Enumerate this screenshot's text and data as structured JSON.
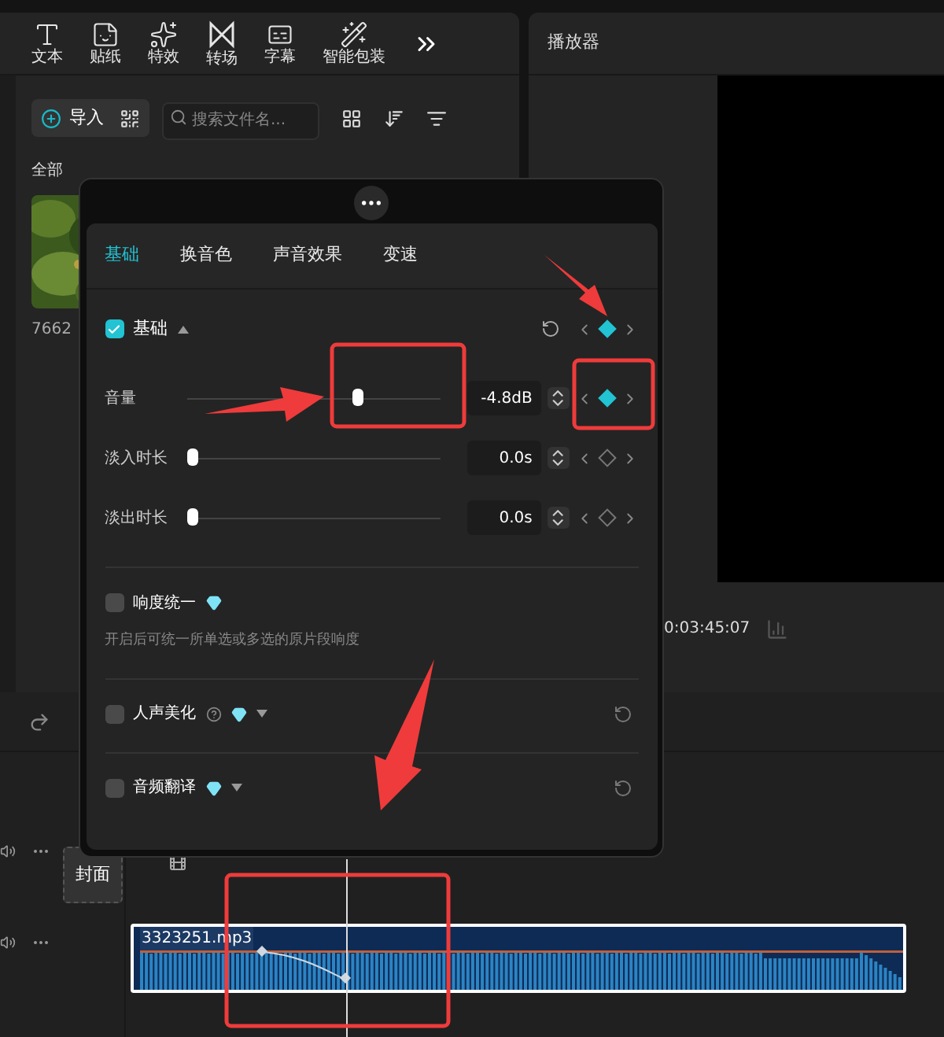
{
  "toolbar": {
    "tools": [
      {
        "label": "文本",
        "kind": "text"
      },
      {
        "label": "贴纸",
        "kind": "sticker"
      },
      {
        "label": "特效",
        "kind": "effect"
      },
      {
        "label": "转场",
        "kind": "transition"
      },
      {
        "label": "字幕",
        "kind": "caption"
      },
      {
        "label": "智能包装",
        "kind": "smart"
      }
    ]
  },
  "media": {
    "import": "导入",
    "search": {
      "placeholder": "搜索文件名..."
    },
    "filter": "全部",
    "items": [
      {
        "name": "7662",
        "kind": "picture"
      }
    ]
  },
  "player": {
    "title": "播放器",
    "timecode": "0:03:45:07"
  },
  "timeline": {
    "cover": "封面",
    "clip": {
      "name": "3323251.mp3"
    }
  },
  "popup": {
    "tabs": [
      {
        "label": "基础",
        "selected": true
      },
      {
        "label": "换音色",
        "selected": false
      },
      {
        "label": "声音效果",
        "selected": false
      },
      {
        "label": "变速",
        "selected": false
      }
    ],
    "basic": {
      "label": "基础",
      "checked": true,
      "expanded": true,
      "keyframe_active": true
    },
    "params": [
      {
        "label": "音量",
        "level": 0.68,
        "value": "-4.8dB",
        "keyframe_active": true
      },
      {
        "label": "淡入时长",
        "level": 0,
        "value": "0.0s",
        "keyframe_active": false
      },
      {
        "label": "淡出时长",
        "level": 0,
        "value": "0.0s",
        "keyframe_active": false
      }
    ],
    "options": [
      {
        "label": "响度统一",
        "checked": false,
        "premium": true,
        "help": false,
        "dropdown": false,
        "reset": false,
        "description": "开启后可统一所单选或多选的原片段响度"
      },
      {
        "label": "人声美化",
        "checked": false,
        "premium": true,
        "help": true,
        "dropdown": true,
        "reset": true
      },
      {
        "label": "音频翻译",
        "checked": false,
        "premium": true,
        "help": false,
        "dropdown": true,
        "reset": true
      }
    ]
  }
}
